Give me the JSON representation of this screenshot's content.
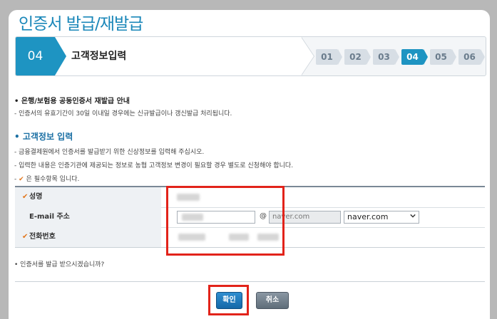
{
  "page": {
    "title": "인증서 발급/재발급"
  },
  "steps": {
    "current_number": "04",
    "current_title": "고객정보입력",
    "items": [
      "01",
      "02",
      "03",
      "04",
      "05",
      "06"
    ],
    "active_index": 3
  },
  "notice": {
    "heading": "• 은행/보험용 공동인증서 재발급 안내",
    "line": "- 인증서의 유효기간이 30일 이내일 경우에는 신규발급이나 갱신발급 처리됩니다."
  },
  "customer_info": {
    "section_title": "• 고객정보 입력",
    "lines": [
      "- 금융결제원에서 인증서를 발급받기 위한 신상정보를 입력해 주십시오.",
      "- 입력한 내용은 인증기관에 제공되는 정보로 농협 고객정보 변경이 필요할 경우 별도로 신청해야 합니다."
    ],
    "required_note": "은 필수항목 입니다.",
    "required_prefix": "-",
    "check_mark": "✔"
  },
  "form": {
    "name_label": "성명",
    "email_label": "E-mail 주소",
    "email_at": "@",
    "email_domain_placeholder": "naver.com",
    "email_domain_select": "naver.com",
    "phone_label": "전화번호"
  },
  "confirm_question": "• 인증서를 발급 받으시겠습니까?",
  "buttons": {
    "ok": "확인",
    "cancel": "취소"
  },
  "colors": {
    "accent": "#1e94c2",
    "highlight": "#e2231a",
    "required": "#e2761c"
  }
}
